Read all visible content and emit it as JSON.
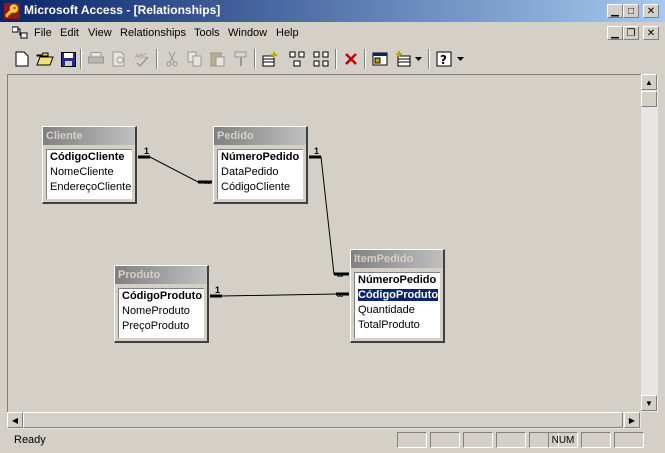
{
  "window": {
    "title": "Microsoft Access - [Relationships]",
    "app_icon": "access-key-icon"
  },
  "menu": {
    "items": [
      {
        "label": "File"
      },
      {
        "label": "Edit"
      },
      {
        "label": "View"
      },
      {
        "label": "Relationships"
      },
      {
        "label": "Tools"
      },
      {
        "label": "Window"
      },
      {
        "label": "Help"
      }
    ]
  },
  "toolbar": {
    "icons": [
      "new-document-icon",
      "open-folder-icon",
      "save-icon",
      "print-icon",
      "print-preview-icon",
      "spelling-icon",
      "cut-icon",
      "copy-icon",
      "paste-icon",
      "format-painter-icon",
      "show-table-icon",
      "show-direct-icon",
      "show-all-icon",
      "delete-icon",
      "database-window-icon",
      "new-object-icon",
      "help-icon"
    ]
  },
  "tables": [
    {
      "name": "Cliente",
      "fields": [
        {
          "label": "CódigoCliente",
          "pk": true
        },
        {
          "label": "NomeCliente"
        },
        {
          "label": "EndereçoCliente"
        }
      ]
    },
    {
      "name": "Pedido",
      "fields": [
        {
          "label": "NúmeroPedido",
          "pk": true
        },
        {
          "label": "DataPedido"
        },
        {
          "label": "CódigoCliente"
        }
      ]
    },
    {
      "name": "Produto",
      "fields": [
        {
          "label": "CódigoProduto",
          "pk": true
        },
        {
          "label": "NomeProduto"
        },
        {
          "label": "PreçoProduto"
        }
      ]
    },
    {
      "name": "ItemPedido",
      "fields": [
        {
          "label": "NúmeroPedido",
          "pk": true
        },
        {
          "label": "CódigoProduto",
          "pk": true,
          "selected": true
        },
        {
          "label": "Quantidade"
        },
        {
          "label": "TotalProduto"
        }
      ]
    }
  ],
  "relationships": [
    {
      "from": "Cliente.CódigoCliente",
      "to": "Pedido.CódigoCliente",
      "one": "1",
      "many": "∞"
    },
    {
      "from": "Pedido.NúmeroPedido",
      "to": "ItemPedido.NúmeroPedido",
      "one": "1",
      "many": "∞"
    },
    {
      "from": "Produto.CódigoProduto",
      "to": "ItemPedido.CódigoProduto",
      "one": "1",
      "many": "∞"
    }
  ],
  "status": {
    "text": "Ready",
    "num": "NUM"
  },
  "colors": {
    "title_active": "#0a246a",
    "title_gradient_end": "#a6caf0",
    "face": "#d4d0c8",
    "selection": "#0a246a"
  }
}
